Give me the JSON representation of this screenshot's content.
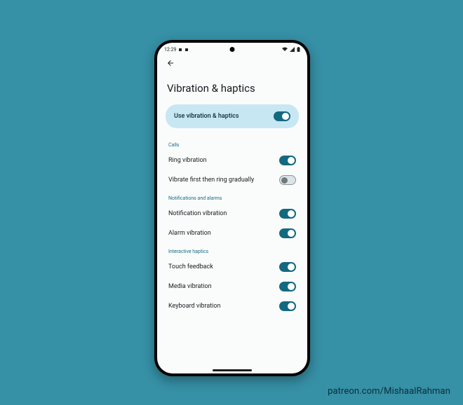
{
  "statusbar": {
    "time": "12:29"
  },
  "page": {
    "title": "Vibration & haptics"
  },
  "master": {
    "label": "Use vibration & haptics",
    "on": true
  },
  "sections": {
    "calls": {
      "header": "Calls",
      "ring": {
        "label": "Ring vibration",
        "on": true
      },
      "vibrate_first": {
        "label": "Vibrate first then ring gradually",
        "on": false
      }
    },
    "notif": {
      "header": "Notifications and alarms",
      "notification": {
        "label": "Notification vibration",
        "on": true
      },
      "alarm": {
        "label": "Alarm vibration",
        "on": true
      }
    },
    "interactive": {
      "header": "Interactive haptics",
      "touch": {
        "label": "Touch feedback",
        "on": true
      },
      "media": {
        "label": "Media vibration",
        "on": true
      },
      "keyboard": {
        "label": "Keyboard vibration",
        "on": true
      }
    }
  },
  "attribution": "patreon.com/MishaalRahman"
}
